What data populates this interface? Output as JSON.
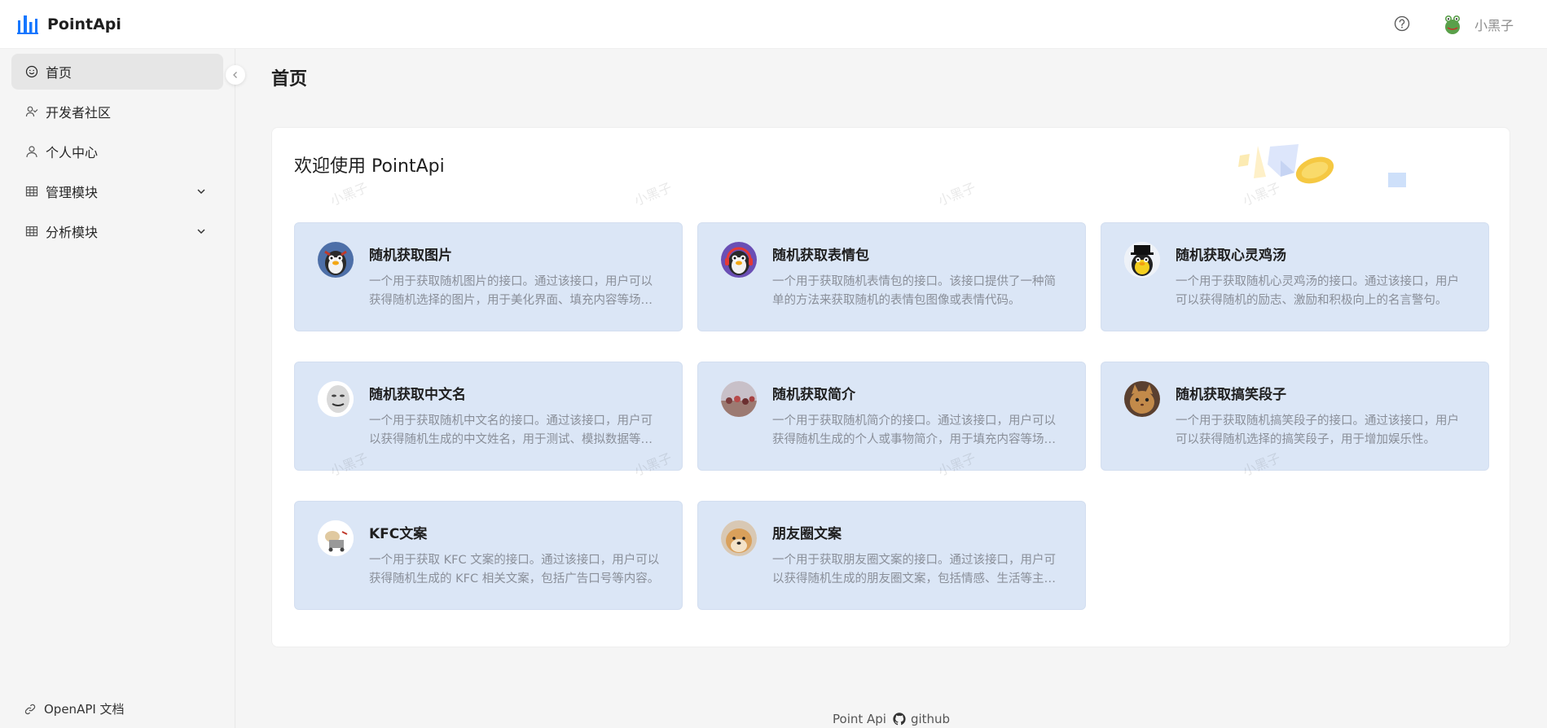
{
  "app": {
    "title": "PointApi"
  },
  "header": {
    "help_icon": "question-circle-icon",
    "user_name": "小黑子"
  },
  "sidebar": {
    "items": [
      {
        "label": "首页",
        "icon": "smile-icon",
        "active": true
      },
      {
        "label": "开发者社区",
        "icon": "community-icon"
      },
      {
        "label": "个人中心",
        "icon": "user-icon"
      },
      {
        "label": "管理模块",
        "icon": "table-icon",
        "expandable": true
      },
      {
        "label": "分析模块",
        "icon": "table-icon",
        "expandable": true
      }
    ],
    "openapi_label": "OpenAPI 文档"
  },
  "main": {
    "page_title": "首页",
    "welcome": "欢迎使用 PointApi",
    "watermark": "小黑子",
    "apis": [
      {
        "title": "随机获取图片",
        "desc": "一个用于获取随机图片的接口。通过该接口，用户可以获得随机选择的图片，用于美化界面、填充内容等场景。"
      },
      {
        "title": "随机获取表情包",
        "desc": "一个用于获取随机表情包的接口。该接口提供了一种简单的方法来获取随机的表情包图像或表情代码。"
      },
      {
        "title": "随机获取心灵鸡汤",
        "desc": "一个用于获取随机心灵鸡汤的接口。通过该接口，用户可以获得随机的励志、激励和积极向上的名言警句。"
      },
      {
        "title": "随机获取中文名",
        "desc": "一个用于获取随机中文名的接口。通过该接口，用户可以获得随机生成的中文姓名，用于测试、模拟数据等场景。"
      },
      {
        "title": "随机获取简介",
        "desc": "一个用于获取随机简介的接口。通过该接口，用户可以获得随机生成的个人或事物简介，用于填充内容等场景。"
      },
      {
        "title": "随机获取搞笑段子",
        "desc": "一个用于获取随机搞笑段子的接口。通过该接口，用户可以获得随机选择的搞笑段子，用于增加娱乐性。"
      },
      {
        "title": "KFC文案",
        "desc": "一个用于获取 KFC 文案的接口。通过该接口，用户可以获得随机生成的 KFC 相关文案，包括广告口号等内容。"
      },
      {
        "title": "朋友圈文案",
        "desc": "一个用于获取朋友圈文案的接口。通过该接口，用户可以获得随机生成的朋友圈文案，包括情感、生活等主题。"
      }
    ]
  },
  "footer": {
    "text": "Point Api",
    "github_label": "github",
    "github_icon": "github-icon"
  },
  "colors": {
    "accent": "#1677ff",
    "card_bg": "#dbe6f6"
  }
}
